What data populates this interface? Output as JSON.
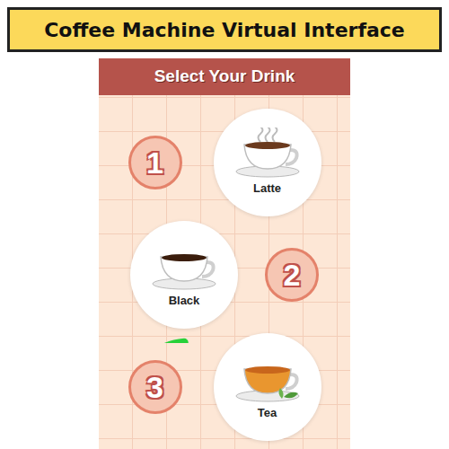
{
  "window": {
    "title": "Coffee Machine Virtual Interface"
  },
  "panel": {
    "title": "Select Your Drink"
  },
  "drinks": [
    {
      "number": "1",
      "label": "Latte",
      "kind": "latte",
      "selected": false
    },
    {
      "number": "2",
      "label": "Black",
      "kind": "black",
      "selected": true
    },
    {
      "number": "3",
      "label": "Tea",
      "kind": "tea",
      "selected": false
    }
  ]
}
